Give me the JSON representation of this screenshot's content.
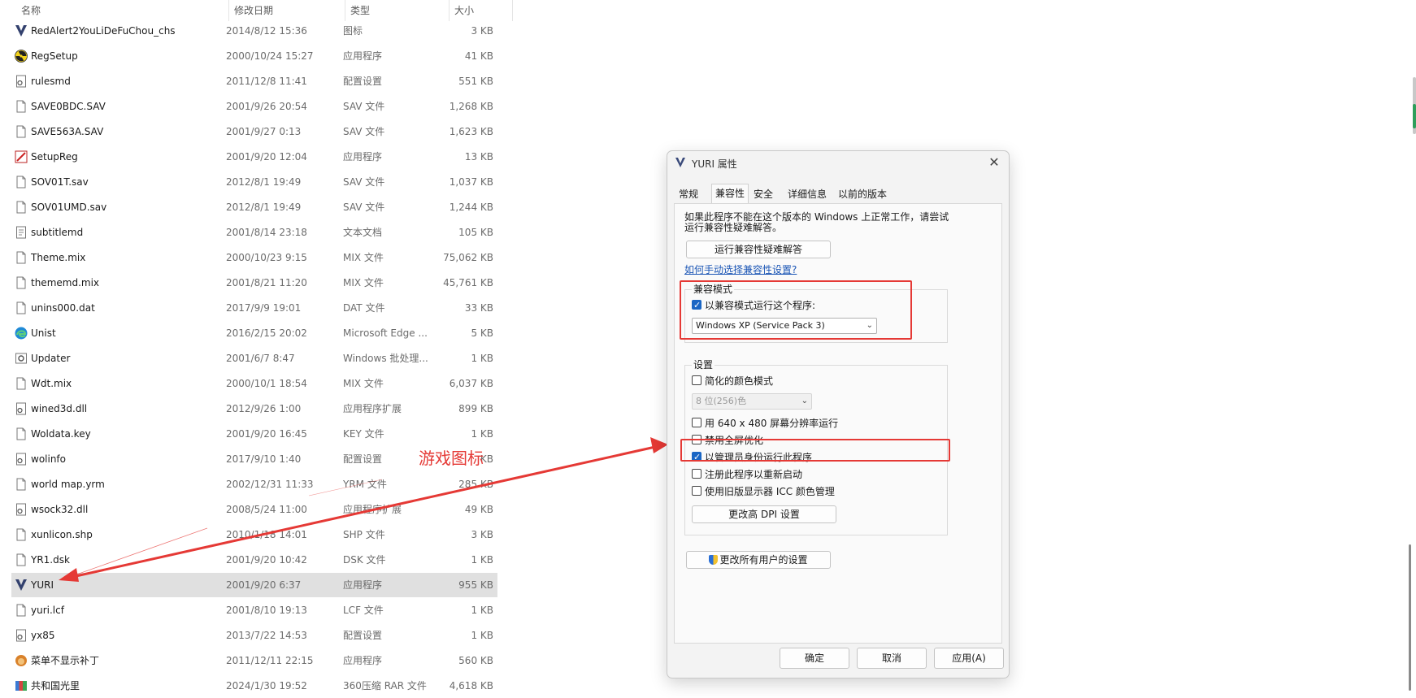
{
  "columns": {
    "name": "名称",
    "date": "修改日期",
    "type": "类型",
    "size": "大小"
  },
  "files": [
    {
      "name": "RedAlert2YouLiDeFuChou_chs",
      "date": "2014/8/12 15:36",
      "type": "图标",
      "size": "3 KB",
      "icon": "yuri-logo-icon"
    },
    {
      "name": "RegSetup",
      "date": "2000/10/24 15:27",
      "type": "应用程序",
      "size": "41 KB",
      "icon": "radiation-icon"
    },
    {
      "name": "rulesmd",
      "date": "2011/12/8 11:41",
      "type": "配置设置",
      "size": "551 KB",
      "icon": "config-file-icon"
    },
    {
      "name": "SAVE0BDC.SAV",
      "date": "2001/9/26 20:54",
      "type": "SAV 文件",
      "size": "1,268 KB",
      "icon": "file-icon"
    },
    {
      "name": "SAVE563A.SAV",
      "date": "2001/9/27 0:13",
      "type": "SAV 文件",
      "size": "1,623 KB",
      "icon": "file-icon"
    },
    {
      "name": "SetupReg",
      "date": "2001/9/20 12:04",
      "type": "应用程序",
      "size": "13 KB",
      "icon": "setup-icon"
    },
    {
      "name": "SOV01T.sav",
      "date": "2012/8/1 19:49",
      "type": "SAV 文件",
      "size": "1,037 KB",
      "icon": "file-icon"
    },
    {
      "name": "SOV01UMD.sav",
      "date": "2012/8/1 19:49",
      "type": "SAV 文件",
      "size": "1,244 KB",
      "icon": "file-icon"
    },
    {
      "name": "subtitlemd",
      "date": "2001/8/14 23:18",
      "type": "文本文档",
      "size": "105 KB",
      "icon": "text-file-icon"
    },
    {
      "name": "Theme.mix",
      "date": "2000/10/23 9:15",
      "type": "MIX 文件",
      "size": "75,062 KB",
      "icon": "file-icon"
    },
    {
      "name": "thememd.mix",
      "date": "2001/8/21 11:20",
      "type": "MIX 文件",
      "size": "45,761 KB",
      "icon": "file-icon"
    },
    {
      "name": "unins000.dat",
      "date": "2017/9/9 19:01",
      "type": "DAT 文件",
      "size": "33 KB",
      "icon": "file-icon"
    },
    {
      "name": "Unist",
      "date": "2016/2/15 20:02",
      "type": "Microsoft Edge ...",
      "size": "5 KB",
      "icon": "edge-icon"
    },
    {
      "name": "Updater",
      "date": "2001/6/7 8:47",
      "type": "Windows 批处理...",
      "size": "1 KB",
      "icon": "batch-file-icon"
    },
    {
      "name": "Wdt.mix",
      "date": "2000/10/1 18:54",
      "type": "MIX 文件",
      "size": "6,037 KB",
      "icon": "file-icon"
    },
    {
      "name": "wined3d.dll",
      "date": "2012/9/26 1:00",
      "type": "应用程序扩展",
      "size": "899 KB",
      "icon": "dll-file-icon"
    },
    {
      "name": "Woldata.key",
      "date": "2001/9/20 16:45",
      "type": "KEY 文件",
      "size": "1 KB",
      "icon": "file-icon"
    },
    {
      "name": "wolinfo",
      "date": "2017/9/10 1:40",
      "type": "配置设置",
      "size": "KB",
      "icon": "config-file-icon"
    },
    {
      "name": "world map.yrm",
      "date": "2002/12/31 11:33",
      "type": "YRM 文件",
      "size": "285 KB",
      "icon": "file-icon"
    },
    {
      "name": "wsock32.dll",
      "date": "2008/5/24 11:00",
      "type": "应用程序扩展",
      "size": "49 KB",
      "icon": "dll-file-icon"
    },
    {
      "name": "xunlicon.shp",
      "date": "2010/1/18 14:01",
      "type": "SHP 文件",
      "size": "3 KB",
      "icon": "file-icon"
    },
    {
      "name": "YR1.dsk",
      "date": "2001/9/20 10:42",
      "type": "DSK 文件",
      "size": "1 KB",
      "icon": "file-icon"
    },
    {
      "name": "YURI",
      "date": "2001/9/20 6:37",
      "type": "应用程序",
      "size": "955 KB",
      "icon": "yuri-logo-icon",
      "selected": true
    },
    {
      "name": "yuri.lcf",
      "date": "2001/8/10 19:13",
      "type": "LCF 文件",
      "size": "1 KB",
      "icon": "file-icon"
    },
    {
      "name": "yx85",
      "date": "2013/7/22 14:53",
      "type": "配置设置",
      "size": "1 KB",
      "icon": "config-file-icon"
    },
    {
      "name": "菜单不显示补丁",
      "date": "2011/12/11 22:15",
      "type": "应用程序",
      "size": "560 KB",
      "icon": "lion-icon"
    },
    {
      "name": "共和国光里",
      "date": "2024/1/30 19:52",
      "type": "360压缩 RAR 文件",
      "size": "4,618 KB",
      "icon": "archive-icon"
    }
  ],
  "annotation": {
    "label": "游戏图标",
    "color": "#e53935"
  },
  "dialog": {
    "title": "YURI 属性",
    "close": "✕",
    "tabs": [
      "常规",
      "兼容性",
      "安全",
      "详细信息",
      "以前的版本"
    ],
    "active_tab": "兼容性",
    "intro": [
      "如果此程序不能在这个版本的 Windows 上正常工作，请尝试",
      "运行兼容性疑难解答。"
    ],
    "troubleshoot_button": "运行兼容性疑难解答",
    "manual_link": "如何手动选择兼容性设置?",
    "compat_group": {
      "label": "兼容模式",
      "checkbox": "以兼容模式运行这个程序:",
      "checked": true,
      "os_value": "Windows XP (Service Pack 3)"
    },
    "settings_group": {
      "label": "设置",
      "reduced_color": "简化的颜色模式",
      "color_value": "8 位(256)色",
      "res_640": "用 640 x 480 屏幕分辨率运行",
      "disable_fullscreen": "禁用全屏优化",
      "run_as_admin": "以管理员身份运行此程序",
      "register_restart": "注册此程序以重新启动",
      "legacy_icc": "使用旧版显示器 ICC 颜色管理",
      "dpi_button": "更改高 DPI 设置"
    },
    "all_users_button": "更改所有用户的设置",
    "ok": "确定",
    "cancel": "取消",
    "apply": "应用(A)"
  }
}
